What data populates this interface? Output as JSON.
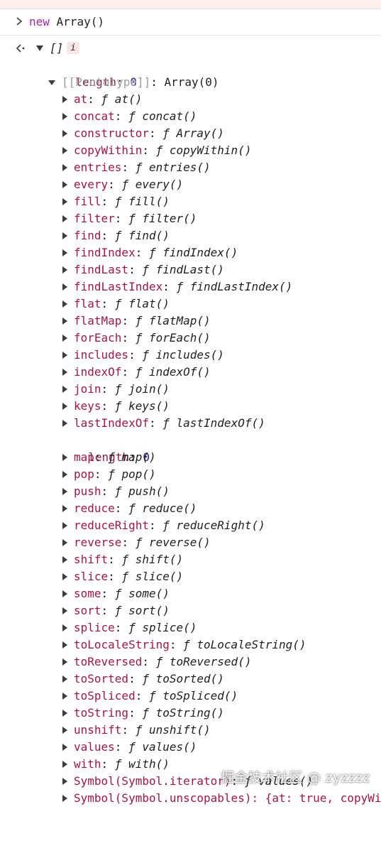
{
  "console": {
    "input": {
      "keyword": "new",
      "rest": " Array()"
    },
    "result": {
      "preview": "[]",
      "info_badge": "i"
    },
    "length_row": {
      "key": "length",
      "value": "0"
    },
    "prototype_row": {
      "key": "[[Prototype]]",
      "value": "Array(0)"
    },
    "methods": [
      {
        "key": "at",
        "sig": "at()"
      },
      {
        "key": "concat",
        "sig": "concat()"
      },
      {
        "key": "constructor",
        "sig": "Array()"
      },
      {
        "key": "copyWithin",
        "sig": "copyWithin()"
      },
      {
        "key": "entries",
        "sig": "entries()"
      },
      {
        "key": "every",
        "sig": "every()"
      },
      {
        "key": "fill",
        "sig": "fill()"
      },
      {
        "key": "filter",
        "sig": "filter()"
      },
      {
        "key": "find",
        "sig": "find()"
      },
      {
        "key": "findIndex",
        "sig": "findIndex()"
      },
      {
        "key": "findLast",
        "sig": "findLast()"
      },
      {
        "key": "findLastIndex",
        "sig": "findLastIndex()"
      },
      {
        "key": "flat",
        "sig": "flat()"
      },
      {
        "key": "flatMap",
        "sig": "flatMap()"
      },
      {
        "key": "forEach",
        "sig": "forEach()"
      },
      {
        "key": "includes",
        "sig": "includes()"
      },
      {
        "key": "indexOf",
        "sig": "indexOf()"
      },
      {
        "key": "join",
        "sig": "join()"
      },
      {
        "key": "keys",
        "sig": "keys()"
      },
      {
        "key": "lastIndexOf",
        "sig": "lastIndexOf()"
      }
    ],
    "proto_length": {
      "key": "length",
      "value": "0"
    },
    "methods2": [
      {
        "key": "map",
        "sig": "map()"
      },
      {
        "key": "pop",
        "sig": "pop()"
      },
      {
        "key": "push",
        "sig": "push()"
      },
      {
        "key": "reduce",
        "sig": "reduce()"
      },
      {
        "key": "reduceRight",
        "sig": "reduceRight()"
      },
      {
        "key": "reverse",
        "sig": "reverse()"
      },
      {
        "key": "shift",
        "sig": "shift()"
      },
      {
        "key": "slice",
        "sig": "slice()"
      },
      {
        "key": "some",
        "sig": "some()"
      },
      {
        "key": "sort",
        "sig": "sort()"
      },
      {
        "key": "splice",
        "sig": "splice()"
      },
      {
        "key": "toLocaleString",
        "sig": "toLocaleString()"
      },
      {
        "key": "toReversed",
        "sig": "toReversed()"
      },
      {
        "key": "toSorted",
        "sig": "toSorted()"
      },
      {
        "key": "toSpliced",
        "sig": "toSpliced()"
      },
      {
        "key": "toString",
        "sig": "toString()"
      },
      {
        "key": "unshift",
        "sig": "unshift()"
      },
      {
        "key": "values",
        "sig": "values()"
      },
      {
        "key": "with",
        "sig": "with()"
      },
      {
        "key": "Symbol(Symbol.iterator)",
        "sig": "values()"
      }
    ],
    "last_row_partial": "Symbol(Symbol.unscopables): {at: true, copyWith"
  },
  "watermark": "掘金技术社区 @ zyzzzz",
  "colors": {
    "key": "#a31547",
    "number": "#1a1aa6",
    "keyword": "#a626a4",
    "error_bar": "#fdf0ef"
  },
  "icons": {
    "prompt": "chevron-right-icon",
    "return": "return-arrow-icon",
    "expand": "triangle-right-icon",
    "collapse": "triangle-down-icon",
    "function": "function-f-icon"
  }
}
